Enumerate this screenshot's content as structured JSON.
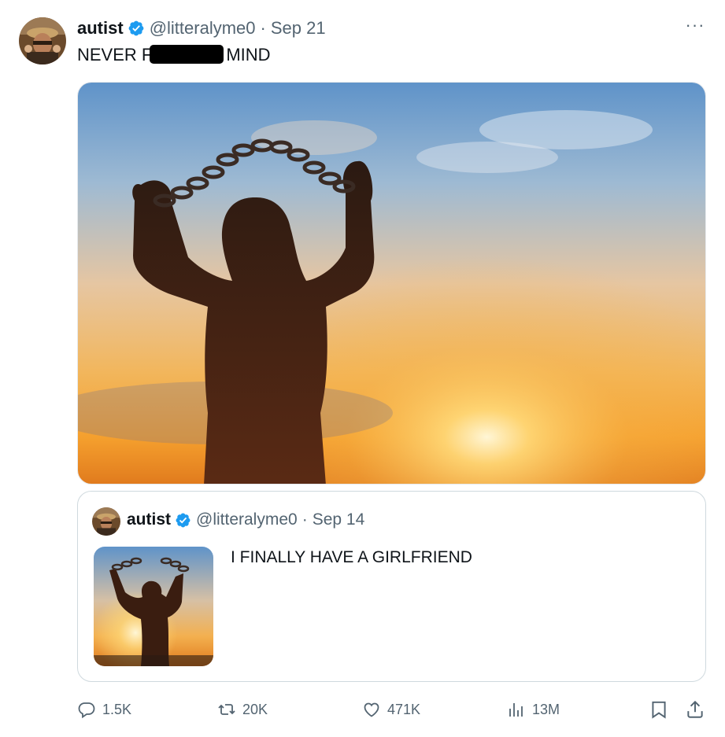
{
  "tweet": {
    "author_name": "autist",
    "handle": "@litteralyme0",
    "separator": "·",
    "date": "Sep 21",
    "text_before": "NEVER F",
    "text_after": "MIND",
    "more_label": "···"
  },
  "quoted": {
    "author_name": "autist",
    "handle": "@litteralyme0",
    "separator": "·",
    "date": "Sep 14",
    "text": "I FINALLY HAVE A GIRLFRIEND"
  },
  "actions": {
    "replies": "1.5K",
    "reposts": "20K",
    "likes": "471K",
    "views": "13M"
  },
  "icons": {
    "verified": "verified-badge-icon",
    "reply": "reply-icon",
    "repost": "repost-icon",
    "like": "heart-icon",
    "views": "views-chart-icon",
    "bookmark": "bookmark-icon",
    "share": "share-icon",
    "more": "more-options-icon"
  },
  "colors": {
    "verified_blue": "#1d9bf0",
    "secondary_text": "#536471",
    "primary_text": "#0f1419",
    "border": "#cfd9de"
  }
}
